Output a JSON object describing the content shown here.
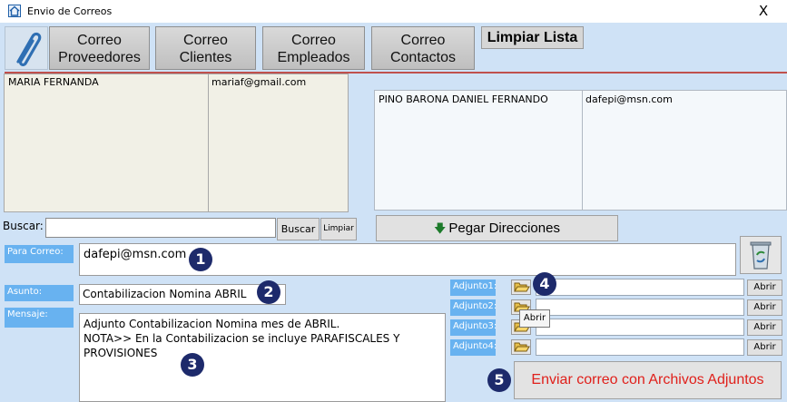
{
  "window": {
    "title": "Envio de Correos",
    "close_label": "X"
  },
  "toolbar": {
    "buttons": [
      {
        "label": "Correo\nProveedores"
      },
      {
        "label": "Correo\nClientes"
      },
      {
        "label": "Correo\nEmpleados"
      },
      {
        "label": "Correo\nContactos"
      }
    ],
    "clear_list_label": "Limpiar Lista"
  },
  "left_list": {
    "rows": [
      {
        "name": "MARIA FERNANDA",
        "email": "mariaf@gmail.com"
      }
    ]
  },
  "right_list": {
    "rows": [
      {
        "name": "PINO BARONA DANIEL FERNANDO",
        "email": "dafepi@msn.com"
      }
    ]
  },
  "search": {
    "label": "Buscar:",
    "value": "",
    "button_label": "Buscar",
    "clear_label": "Limpiar"
  },
  "paste_button_label": "Pegar Direcciones",
  "fields": {
    "para": {
      "label": "Para Correo:",
      "value": "dafepi@msn.com"
    },
    "asunto": {
      "label": "Asunto:",
      "value": "Contabilizacion Nomina ABRIL"
    },
    "mensaje": {
      "label": "Mensaje:",
      "value": "Adjunto Contabilizacion Nomina mes de ABRIL.\nNOTA>> En la Contabilizacion se incluye PARAFISCALES Y PROVISIONES"
    }
  },
  "attachments": [
    {
      "label": "Adjunto1:",
      "value": "",
      "open_label": "Abrir"
    },
    {
      "label": "Adjunto2:",
      "value": "",
      "open_label": "Abrir"
    },
    {
      "label": "Adjunto3:",
      "value": "",
      "open_label": "Abrir"
    },
    {
      "label": "Adjunto4:",
      "value": "",
      "open_label": "Abrir"
    }
  ],
  "tooltip": "Abrir",
  "send_button_label": "Enviar correo con Archivos Adjuntos",
  "markers": [
    "1",
    "2",
    "3",
    "4",
    "5"
  ],
  "colors": {
    "form_bg": "#cfe2f6",
    "label_bg": "#68b2f0",
    "separator": "#c0504d",
    "send_text": "#e0201b",
    "marker": "#1d2a6b"
  },
  "icons": [
    "home-icon",
    "paperclip-icon",
    "folder-open-icon",
    "recycle-bin-icon",
    "arrow-down-icon"
  ]
}
